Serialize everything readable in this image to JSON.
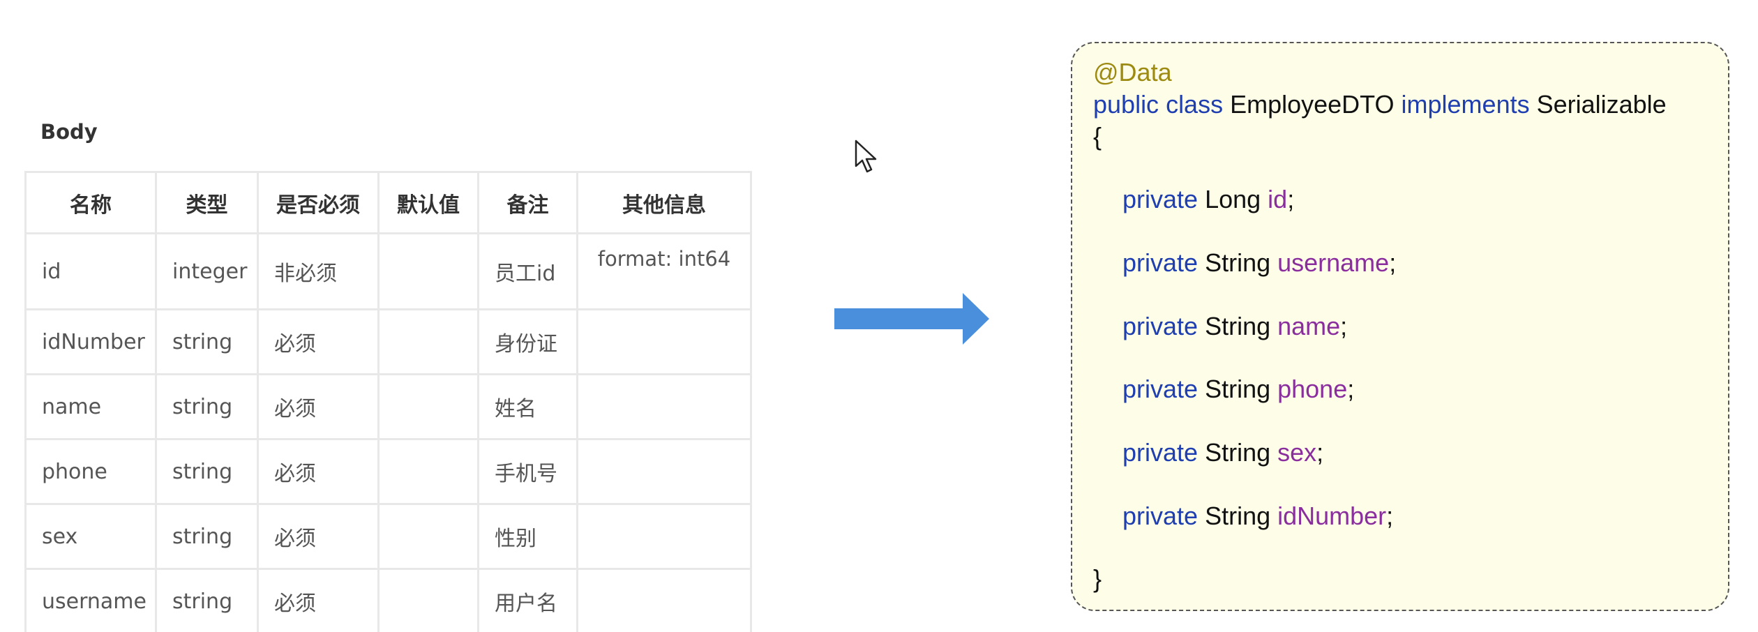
{
  "body_label": "Body",
  "table": {
    "headers": [
      "名称",
      "类型",
      "是否必须",
      "默认值",
      "备注",
      "其他信息"
    ],
    "rows": [
      {
        "name": "id",
        "type": "integer",
        "required": "非必须",
        "default": "",
        "remark": "员工id",
        "extra": "format: int64"
      },
      {
        "name": "idNumber",
        "type": "string",
        "required": "必须",
        "default": "",
        "remark": "身份证",
        "extra": ""
      },
      {
        "name": "name",
        "type": "string",
        "required": "必须",
        "default": "",
        "remark": "姓名",
        "extra": ""
      },
      {
        "name": "phone",
        "type": "string",
        "required": "必须",
        "default": "",
        "remark": "手机号",
        "extra": ""
      },
      {
        "name": "sex",
        "type": "string",
        "required": "必须",
        "default": "",
        "remark": "性别",
        "extra": ""
      },
      {
        "name": "username",
        "type": "string",
        "required": "必须",
        "default": "",
        "remark": "用户名",
        "extra": ""
      }
    ]
  },
  "code": {
    "annotation": "@Data",
    "kw_public_class": "public class",
    "class_name": " EmployeeDTO ",
    "kw_implements": "implements",
    "interface_name": " Serializable",
    "open_brace": "{",
    "close_brace": "}",
    "fields": [
      {
        "modifier": "private",
        "type": " Long ",
        "name": "id",
        "end": ";"
      },
      {
        "modifier": "private",
        "type": " String ",
        "name": "username",
        "end": ";"
      },
      {
        "modifier": "private",
        "type": " String ",
        "name": "name",
        "end": ";"
      },
      {
        "modifier": "private",
        "type": " String ",
        "name": "phone",
        "end": ";"
      },
      {
        "modifier": "private",
        "type": " String ",
        "name": "sex",
        "end": ";"
      },
      {
        "modifier": "private",
        "type": " String ",
        "name": "idNumber",
        "end": ";"
      }
    ]
  },
  "colors": {
    "arrow": "#4a8fdb",
    "keyword": "#1f3fb0",
    "annotation": "#9c8a12",
    "field": "#8a2e9e",
    "code_background": "#fefee8"
  },
  "icons": {
    "cursor": "mouse-pointer-icon",
    "arrow": "right-arrow-icon"
  }
}
